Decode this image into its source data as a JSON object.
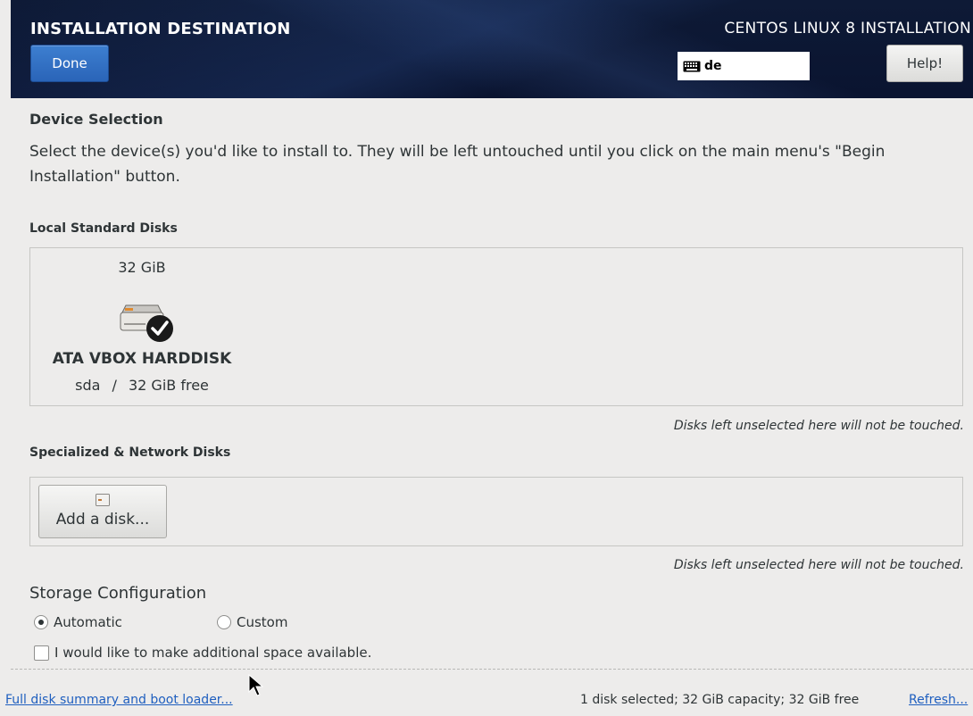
{
  "header": {
    "screen_title": "INSTALLATION DESTINATION",
    "done_label": "Done",
    "product_title": "CENTOS LINUX 8 INSTALLATION",
    "keyboard_layout": "de",
    "help_label": "Help!",
    "bg_color": "#0b1630",
    "done_color": "#3470c4"
  },
  "device_selection": {
    "heading": "Device Selection",
    "description": "Select the device(s) you'd like to install to.  They will be left untouched until you click on the main menu's \"Begin Installation\" button."
  },
  "local_disks": {
    "heading": "Local Standard Disks",
    "disks": [
      {
        "size": "32 GiB",
        "name": "ATA VBOX HARDDISK",
        "device": "sda",
        "separator": "/",
        "free": "32 GiB free",
        "selected": true,
        "icon": "harddisk-icon"
      }
    ],
    "hint": "Disks left unselected here will not be touched."
  },
  "specialized_disks": {
    "heading": "Specialized & Network Disks",
    "add_label": "Add a disk...",
    "hint": "Disks left unselected here will not be touched."
  },
  "storage_configuration": {
    "heading": "Storage Configuration",
    "options": [
      {
        "label": "Automatic",
        "selected": true
      },
      {
        "label": "Custom",
        "selected": false
      }
    ],
    "reclaim_label": "I would like to make additional space available.",
    "reclaim_checked": false
  },
  "footer": {
    "summary_link": "Full disk summary and boot loader...",
    "status": "1 disk selected; 32 GiB capacity; 32 GiB free",
    "refresh_link": "Refresh..."
  }
}
